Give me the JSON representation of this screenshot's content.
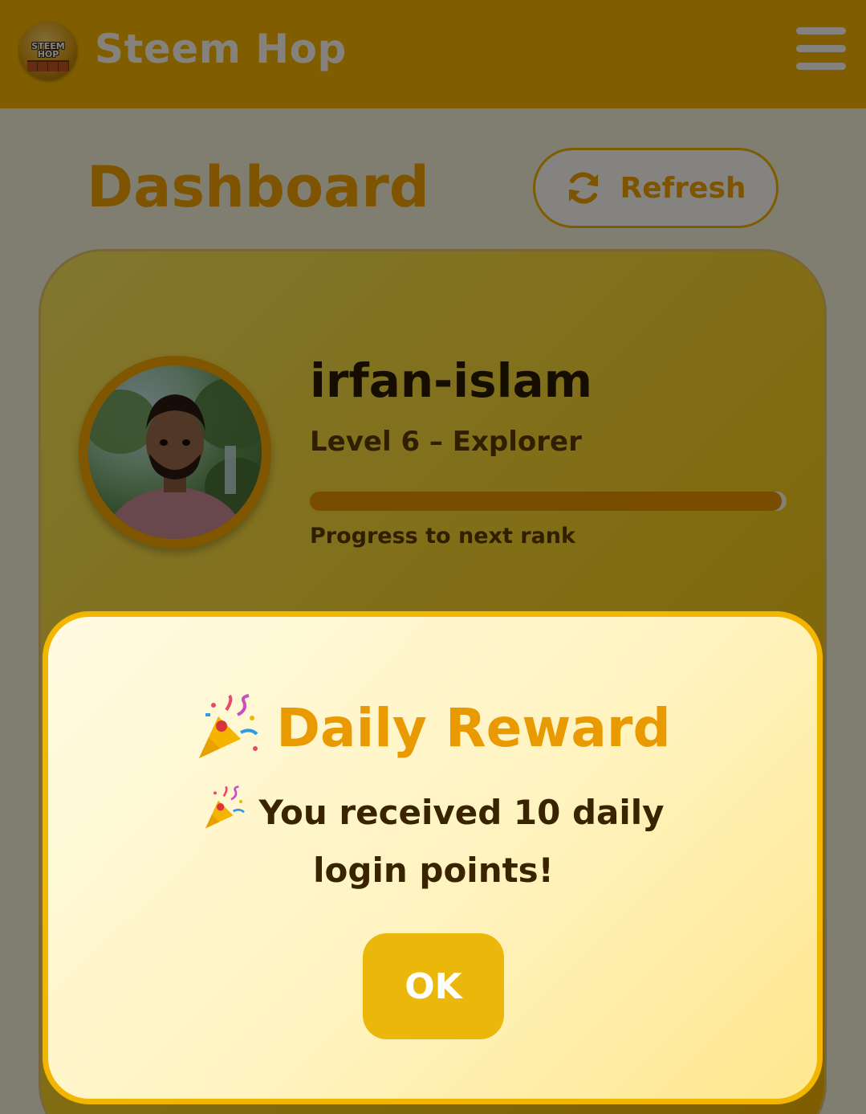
{
  "header": {
    "logo_text": "STEEM HOP",
    "title": "Steem Hop"
  },
  "page": {
    "title": "Dashboard",
    "refresh_label": "Refresh"
  },
  "profile": {
    "username": "irfan-islam",
    "level": "Level 6 – Explorer",
    "progress_label": "Progress to next rank",
    "progress_fraction": 0.99
  },
  "modal": {
    "title": "Daily Reward",
    "message": "You received 10 daily login points!",
    "ok_label": "OK",
    "icon": "party-popper-icon"
  },
  "colors": {
    "header": "#f5b400",
    "accent": "#f2a200",
    "modal_border": "#f2b600",
    "ok_button": "#ebb70a"
  }
}
